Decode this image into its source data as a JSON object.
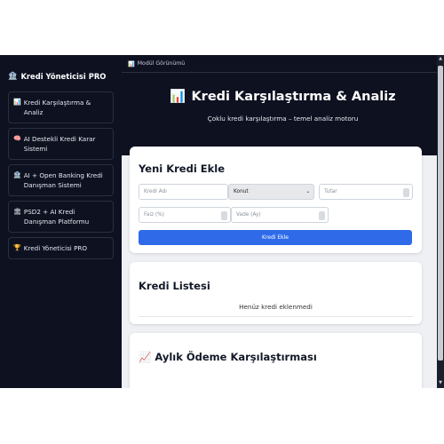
{
  "sidebar": {
    "title_icon": "🏦",
    "title": "Kredi Yöneticisi PRO",
    "items": [
      {
        "icon": "📊",
        "label": "Kredi Karşılaştırma & Analiz"
      },
      {
        "icon": "🧠",
        "label": "AI Destekli Kredi Karar Sistemi"
      },
      {
        "icon": "🏦",
        "label": "AI + Open Banking Kredi Danışman Sistemi"
      },
      {
        "icon": "🏛",
        "label": "PSD2 + AI Kredi Danışman Platformu"
      },
      {
        "icon": "🏆",
        "label": "Kredi Yöneticisi PRO"
      }
    ]
  },
  "topbar": {
    "icon": "📊",
    "label": "Modül Görünümü"
  },
  "hero": {
    "icon": "📊",
    "title": "Kredi Karşılaştırma & Analiz",
    "subtitle": "Çoklu kredi karşılaştırma – temel analiz motoru"
  },
  "form": {
    "title": "Yeni Kredi Ekle",
    "name_placeholder": "Kredi Adı",
    "type_selected": "Konut",
    "amount_placeholder": "Tutar",
    "rate_placeholder": "Faiz (%)",
    "term_placeholder": "Vade (Ay)",
    "add_button": "Kredi Ekle"
  },
  "list": {
    "title": "Kredi Listesi",
    "empty": "Henüz kredi eklenmedi"
  },
  "payments": {
    "icon": "📈",
    "title": "Aylık Ödeme Karşılaştırması"
  },
  "colors": {
    "sidebar_bg": "#0d1120",
    "accent": "#2f6be9"
  }
}
